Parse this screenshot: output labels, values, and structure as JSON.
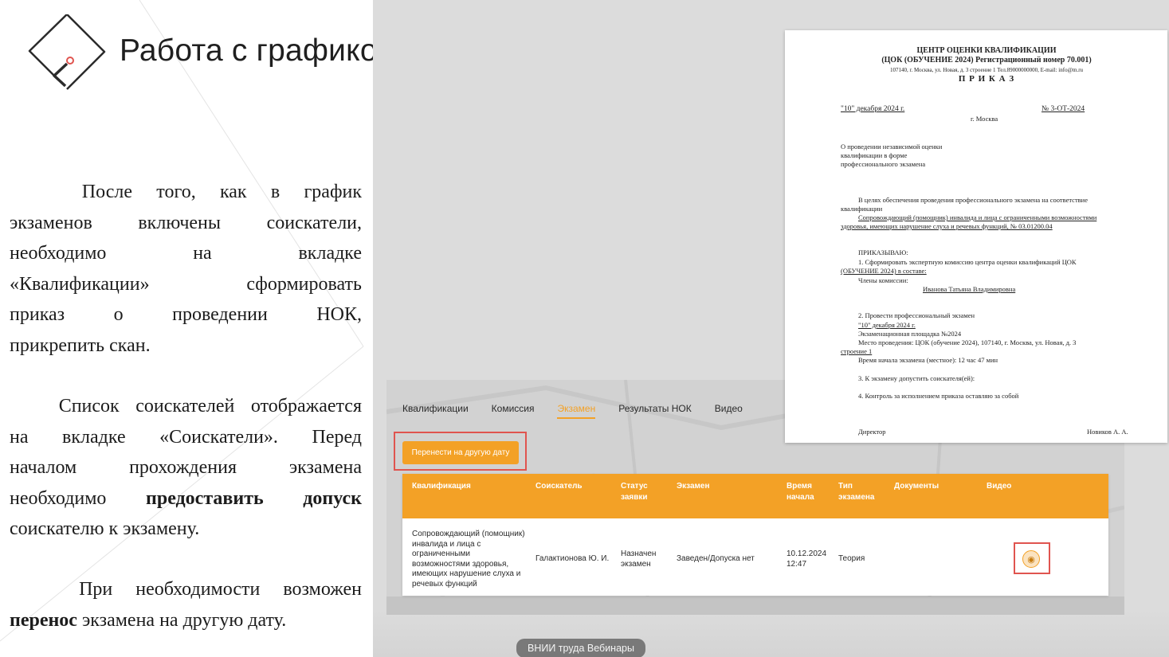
{
  "slide": {
    "title": "Работа с  графиком экзаменов",
    "paragraph1": [
      "После",
      "того,",
      "как",
      "в",
      "график",
      "экзаменов",
      "включены",
      "соискатели,",
      "необходимо",
      "на",
      "вкладке",
      "«Квалификации»",
      "сформировать",
      "приказ",
      "о",
      "проведении",
      "НОК,",
      "прикрепить скан."
    ],
    "paragraph2": {
      "l1": [
        "Список",
        "соискателей",
        "отображается"
      ],
      "l2": [
        "на",
        "вкладке",
        "«Соискатели».",
        "Перед"
      ],
      "l3": [
        "началом",
        "прохождения",
        "экзамена"
      ],
      "l4_a": "необходимо",
      "l4_b": "предоставить допуск",
      "l5": "соискателю к экзамену."
    },
    "paragraph3": {
      "l1": [
        "При",
        "необходимости",
        "возможен"
      ],
      "l2_bold": "перенос",
      "l2_rest": " экзамена на другую дату."
    }
  },
  "app": {
    "tabs": [
      {
        "label": "Квалификации",
        "active": false
      },
      {
        "label": "Комиссия",
        "active": false
      },
      {
        "label": "Экзамен",
        "active": true
      },
      {
        "label": "Результаты НОК",
        "active": false
      },
      {
        "label": "Видео",
        "active": false
      }
    ],
    "move_button": "Перенести на другую дату",
    "table": {
      "headers": [
        "Квалификация",
        "Соискатель",
        "Статус заявки",
        "Экзамен",
        "Время начала",
        "Тип экзамена",
        "Документы",
        "Видео"
      ],
      "row": {
        "qualification": "Сопровождающий (помощник) инвалида и лица с ограниченными возможностями здоровья, имеющих нарушение слуха и речевых функций",
        "candidate": "Галактионова Ю. И.",
        "status": "Назначен экзамен",
        "exam": "Заведен/Допуска нет",
        "start_time": "10.12.2024 12:47",
        "exam_type": "Теория",
        "documents": "",
        "video_icon": "video-camera-icon"
      }
    }
  },
  "document": {
    "org1": "ЦЕНТР ОЦЕНКИ КВАЛИФИКАЦИИ",
    "org2": "(ЦОК (ОБУЧЕНИЕ 2024) Регистрационный номер 70.001)",
    "address": "107140, г. Москва, ул. Новая, д. 3 строение 1  Тел.89000000000, E-mail: info@m.ru",
    "order_title": "П Р И К А З",
    "date": "\"10\" декабря 2024 г.",
    "number": "№ 3-ОТ-2024",
    "city": "г. Москва",
    "subject1": "О проведении независимой оценки",
    "subject2": "квалификации        в        форме",
    "subject3": "профессионального экзамена",
    "purpose1": "В целях обеспечения проведения профессионального экзамена на соответствие",
    "purpose2": "квалификации",
    "purpose3": "Сопровождающий (помощник) инвалида и лица с ограниченными возможностями",
    "purpose4": "здоровья, имеющих нарушение слуха и речевых функций, № 03.01200.04",
    "order": "ПРИКАЗЫВАЮ:",
    "item1a": "1.  Сформировать  экспертную  комиссию  центра  оценки  квалификаций  ЦОК",
    "item1b": "(ОБУЧЕНИЕ 2024) в составе:",
    "members": "Члены комиссии:",
    "member_name": "Иванова Татьяна Владимировна",
    "item2": "2. Провести профессиональный экзамен",
    "item2_date": "\"10\" декабря 2024 г.",
    "item2_site": "Экзаменационная площадка №2024",
    "item2_place": "Место проведения: ЦОК (обучение 2024), 107140, г. Москва, ул. Новая, д. 3",
    "item2_place2": "строение 1",
    "item2_time": "Время начала экзамена (местное): 12 час 47 мин",
    "item3": "3. К экзамену  допустить соискателя(ей):",
    "item4": "4. Контроль за исполнением приказа оставляю за собой",
    "director": "Директор",
    "director_name": "Новиков А. А."
  },
  "watermark": "ВНИИ труда Вебинары",
  "colors": {
    "accent": "#f3a126",
    "highlight_frame": "#e0544f",
    "right_bg": "#dcdcdc"
  }
}
